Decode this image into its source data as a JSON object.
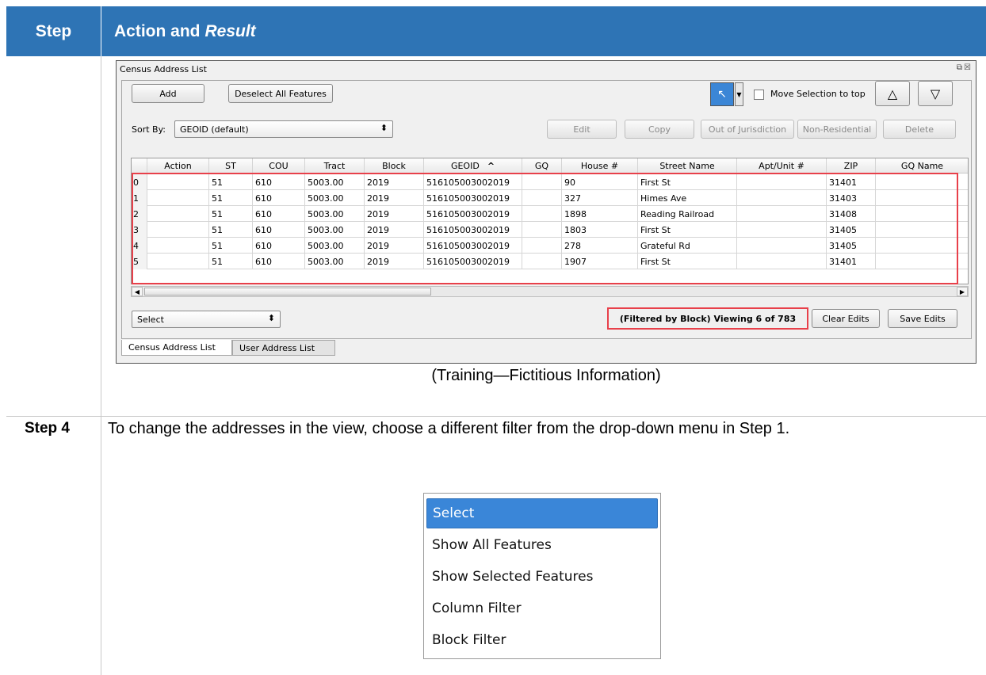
{
  "header": {
    "step_label": "Step",
    "action_label": "Action and",
    "result_label": "Result"
  },
  "window": {
    "title": "Census Address List",
    "buttons": {
      "add": "Add",
      "deselect_all": "Deselect All Features",
      "edit": "Edit",
      "copy": "Copy",
      "out_of_jurisdiction": "Out of Jurisdiction",
      "non_residential": "Non-Residential",
      "delete": "Delete",
      "clear_edits": "Clear Edits",
      "save_edits": "Save Edits"
    },
    "move_selection_label": "Move Selection to top",
    "sort_by_label": "Sort By:",
    "sort_by_value": "GEOID (default)",
    "filter_select_value": "Select",
    "status_text": "(Filtered by Block) Viewing 6 of 783",
    "columns": [
      "Action",
      "ST",
      "COU",
      "Tract",
      "Block",
      "GEOID",
      "GQ",
      "House #",
      "Street Name",
      "Apt/Unit #",
      "ZIP",
      "GQ Name"
    ],
    "rows": [
      {
        "idx": "0",
        "action": "",
        "st": "51",
        "cou": "610",
        "tract": "5003.00",
        "block": "2019",
        "geoid": "516105003002019",
        "gq": "",
        "house": "90",
        "street": "First St",
        "apt": "",
        "zip": "31401",
        "gqname": ""
      },
      {
        "idx": "1",
        "action": "",
        "st": "51",
        "cou": "610",
        "tract": "5003.00",
        "block": "2019",
        "geoid": "516105003002019",
        "gq": "",
        "house": "327",
        "street": "Himes Ave",
        "apt": "",
        "zip": "31403",
        "gqname": ""
      },
      {
        "idx": "2",
        "action": "",
        "st": "51",
        "cou": "610",
        "tract": "5003.00",
        "block": "2019",
        "geoid": "516105003002019",
        "gq": "",
        "house": "1898",
        "street": "Reading Railroad",
        "apt": "",
        "zip": "31408",
        "gqname": ""
      },
      {
        "idx": "3",
        "action": "",
        "st": "51",
        "cou": "610",
        "tract": "5003.00",
        "block": "2019",
        "geoid": "516105003002019",
        "gq": "",
        "house": "1803",
        "street": "First St",
        "apt": "",
        "zip": "31405",
        "gqname": ""
      },
      {
        "idx": "4",
        "action": "",
        "st": "51",
        "cou": "610",
        "tract": "5003.00",
        "block": "2019",
        "geoid": "516105003002019",
        "gq": "",
        "house": "278",
        "street": "Grateful Rd",
        "apt": "",
        "zip": "31405",
        "gqname": ""
      },
      {
        "idx": "5",
        "action": "",
        "st": "51",
        "cou": "610",
        "tract": "5003.00",
        "block": "2019",
        "geoid": "516105003002019",
        "gq": "",
        "house": "1907",
        "street": "First St",
        "apt": "",
        "zip": "31401",
        "gqname": ""
      }
    ],
    "tabs": [
      "Census Address List",
      "User Address List"
    ]
  },
  "caption": "(Training—Fictitious Information)",
  "step4": {
    "label": "Step 4",
    "text": "To change the addresses in the view, choose a different filter from the drop-down menu in Step 1."
  },
  "dropdown_items": [
    "Select",
    "Show All Features",
    "Show Selected Features",
    "Column Filter",
    "Block Filter"
  ],
  "colors": {
    "header_blue": "#2e74b5",
    "highlight_red": "#e8404a",
    "selection_blue": "#3a86d8"
  }
}
